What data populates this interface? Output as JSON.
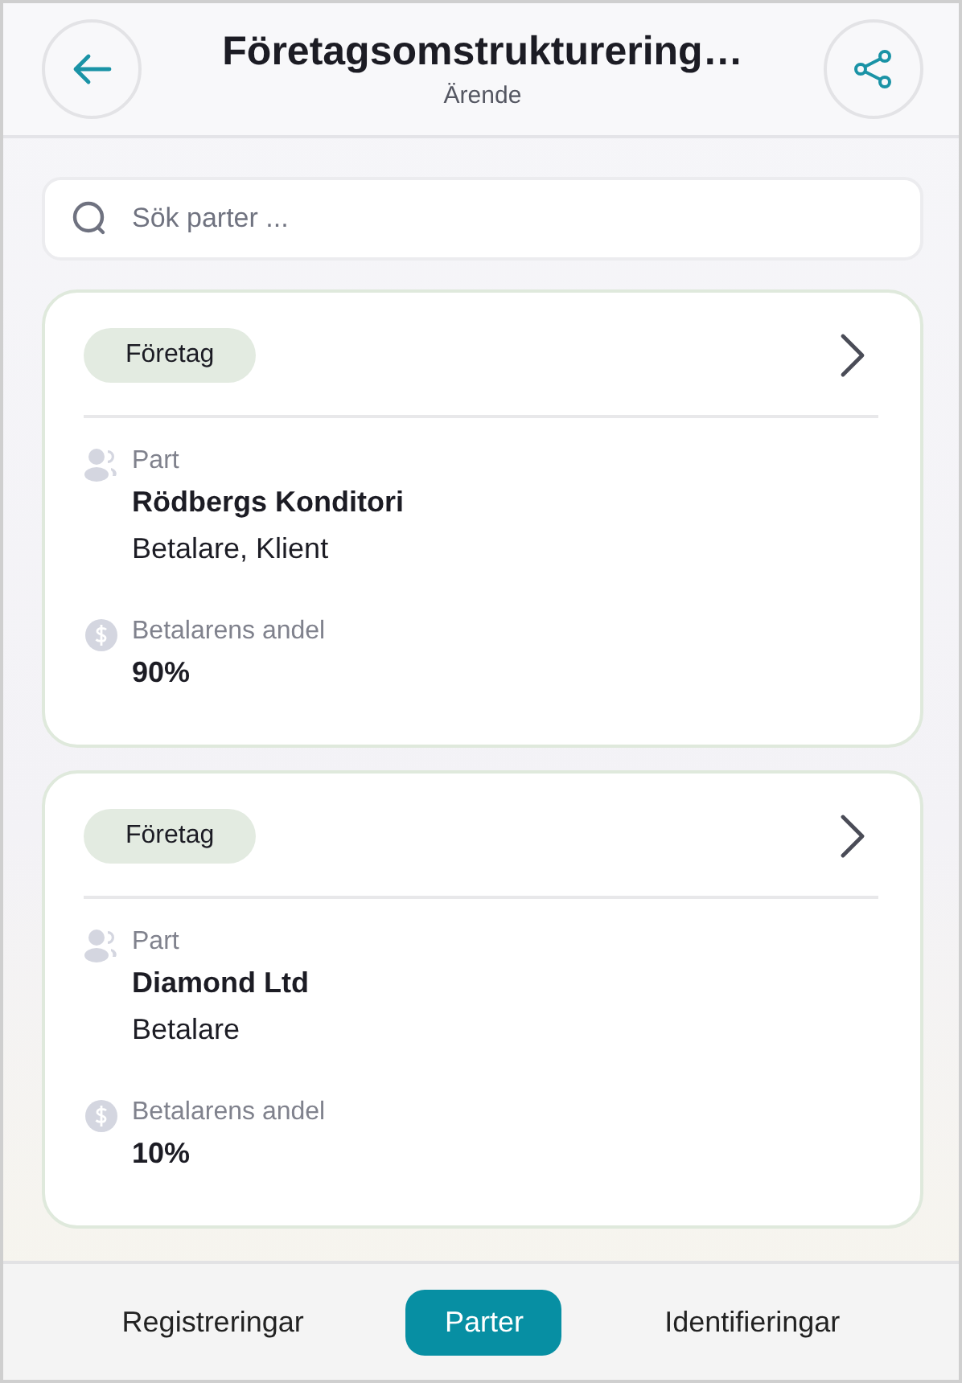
{
  "header": {
    "title": "Företagsomstrukturering…",
    "subtitle": "Ärende"
  },
  "search": {
    "placeholder": "Sök parter ..."
  },
  "parties": [
    {
      "tag": "Företag",
      "part_label": "Part",
      "name": "Rödbergs Konditori",
      "roles": "Betalare, Klient",
      "share_label": "Betalarens andel",
      "share": "90%"
    },
    {
      "tag": "Företag",
      "part_label": "Part",
      "name": "Diamond Ltd",
      "roles": "Betalare",
      "share_label": "Betalarens andel",
      "share": "10%"
    }
  ],
  "tabs": [
    {
      "label": "Registreringar",
      "selected": false
    },
    {
      "label": "Parter",
      "selected": true
    },
    {
      "label": "Identifieringar",
      "selected": false
    }
  ]
}
